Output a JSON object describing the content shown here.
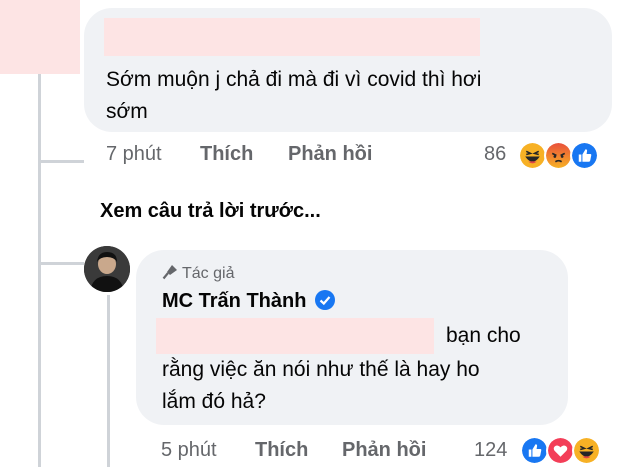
{
  "comment1": {
    "text": "Sớm muộn j chả đi mà đi vì covid thì hơi sớm",
    "time": "7 phút",
    "like_label": "Thích",
    "reply_label": "Phản hồi",
    "reaction_count": "86",
    "reactions": [
      "haha",
      "angry",
      "like"
    ]
  },
  "see_previous": "Xem câu trả lời trước...",
  "reply": {
    "badge": "Tác giả",
    "author": "MC Trấn Thành",
    "text_line1": "bạn cho",
    "text_line2": "rằng việc ăn nói như thế là hay ho",
    "text_line3": "lắm đó hả?",
    "time": "5 phút",
    "like_label": "Thích",
    "reply_label": "Phản hồi",
    "reaction_count": "124",
    "reactions": [
      "like",
      "love",
      "haha"
    ]
  },
  "colors": {
    "bubble": "#f0f2f5",
    "meta": "#65676b",
    "verified": "#1877f2",
    "redaction": "#fde4e4"
  }
}
